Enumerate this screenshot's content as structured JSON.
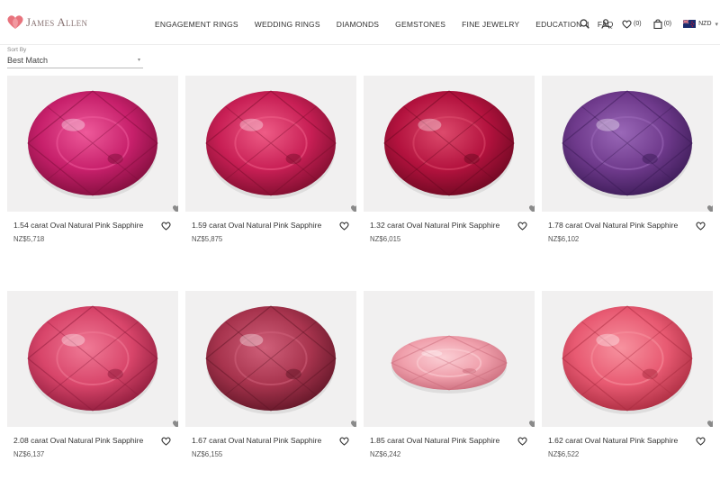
{
  "header": {
    "brand": "James Allen",
    "nav": [
      "ENGAGEMENT RINGS",
      "WEDDING RINGS",
      "DIAMONDS",
      "GEMSTONES",
      "FINE JEWELRY",
      "EDUCATION",
      "FAQ"
    ],
    "nav_separator": "|",
    "wishlist_count": "(0)",
    "cart_count": "(0)",
    "currency": "NZD",
    "currency_caret": "▾"
  },
  "sort": {
    "label": "Sort By",
    "value": "Best Match",
    "caret": "▾"
  },
  "products": [
    {
      "title": "1.54 carat Oval Natural Pink Sapphire",
      "price": "NZ$5,718",
      "gem_color": "#c7206b",
      "gem_dark": "#7d0d3a",
      "gem_light": "#ee5a9a"
    },
    {
      "title": "1.59 carat Oval Natural Pink Sapphire",
      "price": "NZ$5,875",
      "gem_color": "#c81f55",
      "gem_dark": "#7a0d2c",
      "gem_light": "#ee5c86"
    },
    {
      "title": "1.32 carat Oval Natural Pink Sapphire",
      "price": "NZ$6,015",
      "gem_color": "#b3123e",
      "gem_dark": "#6a0820",
      "gem_light": "#dd4a6c"
    },
    {
      "title": "1.78 carat Oval Natural Pink Sapphire",
      "price": "NZ$6,102",
      "gem_color": "#6f3a8c",
      "gem_dark": "#3a1a55",
      "gem_light": "#9a68b8"
    },
    {
      "title": "2.08 carat Oval Natural Pink Sapphire",
      "price": "NZ$6,137",
      "gem_color": "#d8456a",
      "gem_dark": "#8b1a3a",
      "gem_light": "#f07a96"
    },
    {
      "title": "1.67 carat Oval Natural Pink Sapphire",
      "price": "NZ$6,155",
      "gem_color": "#a8344e",
      "gem_dark": "#5f1526",
      "gem_light": "#d0607a"
    },
    {
      "title": "1.85 carat Oval Natural Pink Sapphire",
      "price": "NZ$6,242",
      "gem_color": "#f0a0ac",
      "gem_dark": "#c96a7a",
      "gem_light": "#fbd0d6"
    },
    {
      "title": "1.62 carat Oval Natural Pink Sapphire",
      "price": "NZ$6,522",
      "gem_color": "#e85a72",
      "gem_dark": "#a82a3e",
      "gem_light": "#f7929f"
    }
  ],
  "icons": {
    "search": "search-icon",
    "account": "user-icon",
    "wishlist": "heart-icon",
    "cart": "bag-icon",
    "flag": "nz-flag-icon"
  }
}
